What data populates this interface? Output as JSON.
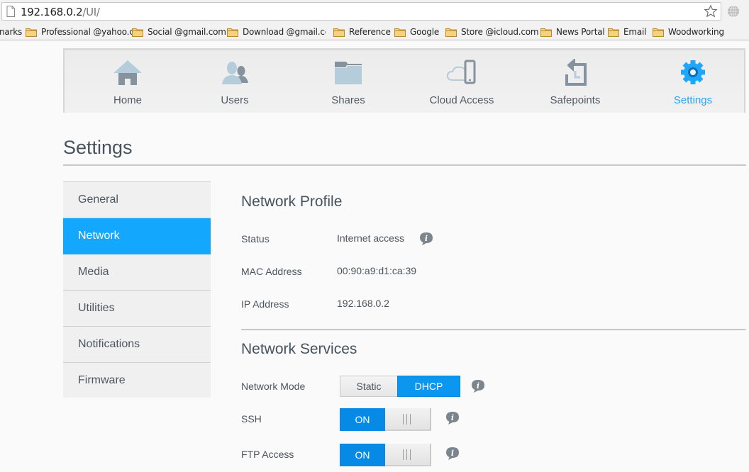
{
  "browser": {
    "url_host": "192.168.0.2",
    "url_path": "/UI/",
    "bookmarks": [
      {
        "label": "narks",
        "folder": false
      },
      {
        "label": "Professional @yahoo.c",
        "folder": true
      },
      {
        "label": "Social @gmail.com",
        "folder": true
      },
      {
        "label": "Download @gmail.co",
        "folder": true
      },
      {
        "label": "Reference",
        "folder": true
      },
      {
        "label": "Google",
        "folder": true
      },
      {
        "label": "Store @icloud.com",
        "folder": true
      },
      {
        "label": "News Portal",
        "folder": true
      },
      {
        "label": "Email",
        "folder": true
      },
      {
        "label": "Woodworking",
        "folder": true
      }
    ]
  },
  "topnav": {
    "items": [
      {
        "label": "Home",
        "icon": "home-icon",
        "active": false
      },
      {
        "label": "Users",
        "icon": "users-icon",
        "active": false
      },
      {
        "label": "Shares",
        "icon": "folder-icon",
        "active": false
      },
      {
        "label": "Cloud Access",
        "icon": "cloud-phone-icon",
        "active": false
      },
      {
        "label": "Safepoints",
        "icon": "safepoint-icon",
        "active": false
      },
      {
        "label": "Settings",
        "icon": "gear-icon",
        "active": true
      }
    ]
  },
  "page": {
    "title": "Settings"
  },
  "sidemenu": {
    "items": [
      {
        "label": "General",
        "active": false
      },
      {
        "label": "Network",
        "active": true
      },
      {
        "label": "Media",
        "active": false
      },
      {
        "label": "Utilities",
        "active": false
      },
      {
        "label": "Notifications",
        "active": false
      },
      {
        "label": "Firmware",
        "active": false
      }
    ]
  },
  "network_profile": {
    "title": "Network Profile",
    "status_label": "Status",
    "status_value": "Internet access",
    "mac_label": "MAC Address",
    "mac_value": "00:90:a9:d1:ca:39",
    "ip_label": "IP Address",
    "ip_value": "192.168.0.2"
  },
  "network_services": {
    "title": "Network Services",
    "mode_label": "Network Mode",
    "mode_options": [
      "Static",
      "DHCP"
    ],
    "mode_selected": "DHCP",
    "ssh_label": "SSH",
    "ssh_state": "ON",
    "ftp_label": "FTP Access",
    "ftp_state": "ON"
  },
  "colors": {
    "accent": "#14a7fe",
    "toggle_on": "#078ae6",
    "active_nav_text": "#29a3f5"
  }
}
